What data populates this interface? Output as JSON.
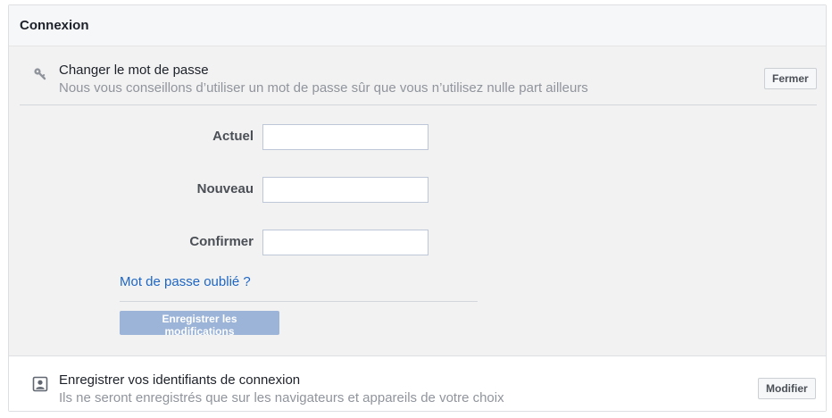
{
  "panel": {
    "title": "Connexion"
  },
  "password_section": {
    "icon": "key-icon",
    "title": "Changer le mot de passe",
    "subtitle": "Nous vous conseillons d’utiliser un mot de passe sûr que vous n’utilisez nulle part ailleurs",
    "close_label": "Fermer",
    "fields": [
      {
        "label": "Actuel",
        "value": ""
      },
      {
        "label": "Nouveau",
        "value": ""
      },
      {
        "label": "Confirmer",
        "value": ""
      }
    ],
    "forgot_link": "Mot de passe oublié ?",
    "save_label": "Enregistrer les modifications"
  },
  "login_info_section": {
    "icon": "id-card-icon",
    "title": "Enregistrer vos identifiants de connexion",
    "subtitle": "Ils ne seront enregistrés que sur les navigateurs et appareils de votre choix",
    "edit_label": "Modifier"
  },
  "colors": {
    "link": "#1e66c4",
    "save_button_disabled": "#9cb4d8",
    "open_section_background": "#f2f2f2"
  }
}
